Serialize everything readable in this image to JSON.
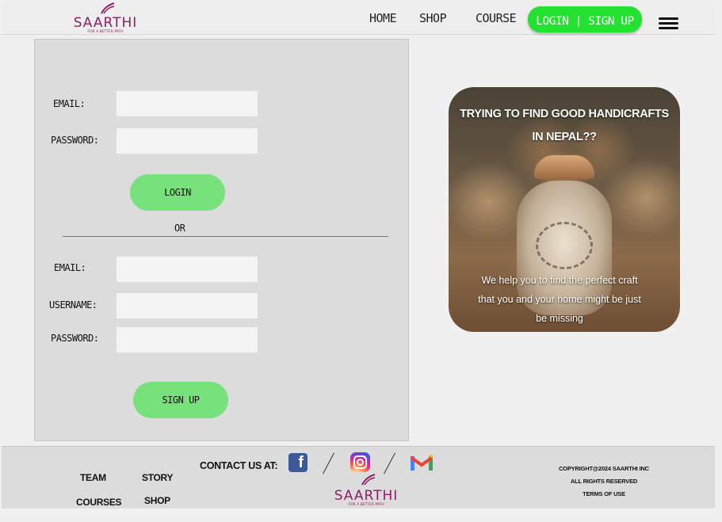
{
  "navbar": {
    "logo_text": "SAARTHI",
    "logo_tagline": "FOR A BETTER PATH",
    "links": [
      "HOME",
      "SHOP",
      "COURSE"
    ],
    "login_label": "LOGIN | SIGN UP"
  },
  "login_form": {
    "email_label": "EMAIL:",
    "password_label": "PASSWORD:",
    "login_button": "LOGIN"
  },
  "separator": "OR",
  "signup_form": {
    "email_label": "EMAIL:",
    "username_label": "USERNAME:",
    "password_label": "PASSWORD:",
    "signup_button": "SIGN UP"
  },
  "promo": {
    "title": "TRYING TO FIND GOOD HANDICRAFTS IN NEPAL??",
    "description": "We help you to find the perfect craft that you and your home might be just be missing"
  },
  "footer": {
    "links": {
      "team": "TEAM",
      "story": "STORY",
      "courses": "COURSES",
      "shop": "SHOP"
    },
    "contact_label": "CONTACT US AT:",
    "logo_text": "SAARTHI",
    "logo_tagline": "FOR A BETTER PATH",
    "copyright": "COPYRIGHT@2024 SAARTHI INC",
    "rights": "ALL RIGHTS RESERVED",
    "terms": "TERMS OF USE"
  },
  "colors": {
    "brand": "#8e1d63",
    "login_pill": "#22e22f",
    "button_green": "#77e27b"
  }
}
